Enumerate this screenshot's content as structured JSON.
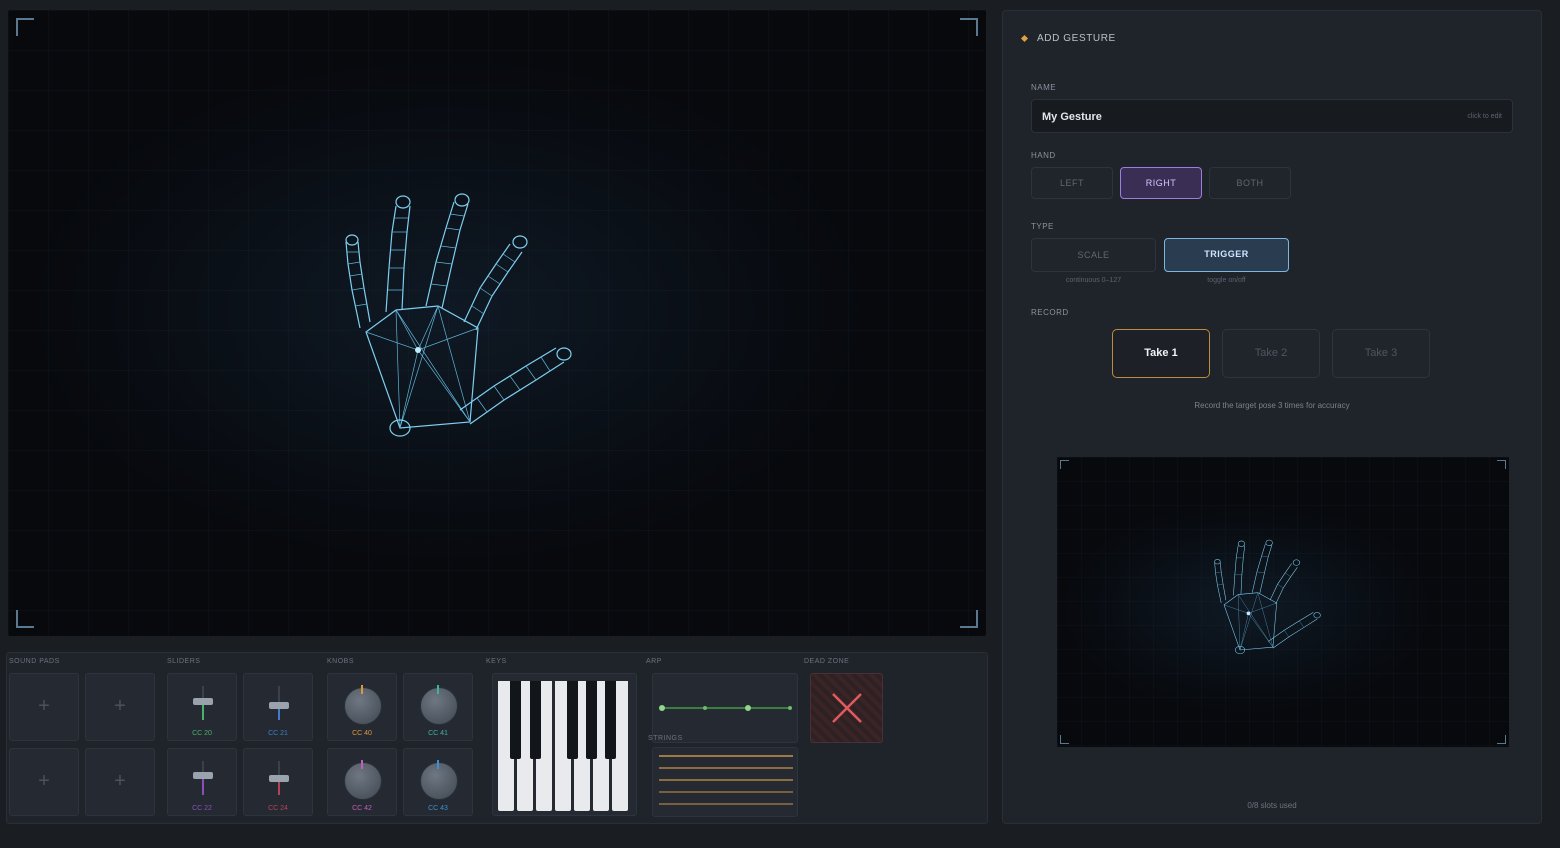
{
  "controls": {
    "groups": {
      "sound_pads": "SOUND PADS",
      "sliders": "SLIDERS",
      "knobs": "KNOBS",
      "keys": "KEYS",
      "arp": "ARP",
      "strings": "STRINGS",
      "dead_zone": "DEAD ZONE"
    },
    "sliders": [
      {
        "cc": "CC 20",
        "color": "#4caf6a",
        "level": 0.55
      },
      {
        "cc": "CC 21",
        "color": "#3f7ec6",
        "level": 0.45
      },
      {
        "cc": "CC 22",
        "color": "#8a4fb8",
        "level": 0.6
      },
      {
        "cc": "CC 24",
        "color": "#b8415a",
        "level": 0.5
      }
    ],
    "knobs": [
      {
        "cc": "CC 40",
        "color": "#e0963c"
      },
      {
        "cc": "CC 41",
        "color": "#3fb39a"
      },
      {
        "cc": "CC 42",
        "color": "#c060b8"
      },
      {
        "cc": "CC 43",
        "color": "#3f8ed0"
      }
    ],
    "pad_icon": "plus-icon",
    "dead_zone_icon": "close-x-icon"
  },
  "panel": {
    "title": "ADD GESTURE",
    "name_label": "NAME",
    "name_value": "My Gesture",
    "name_hint": "click to edit",
    "hand_label": "HAND",
    "hand_options": [
      "LEFT",
      "RIGHT",
      "BOTH"
    ],
    "hand_selected": "RIGHT",
    "type_label": "TYPE",
    "type_options": [
      {
        "label": "SCALE",
        "sub": "continuous 0–127"
      },
      {
        "label": "TRIGGER",
        "sub": "toggle on/off"
      }
    ],
    "type_selected": "TRIGGER",
    "record_label": "RECORD",
    "takes": [
      "Take 1",
      "Take 2",
      "Take 3"
    ],
    "take_current": "Take 1",
    "record_hint": "Record the target pose 3 times for accuracy",
    "slots_text": "0/8 slots used"
  },
  "colors": {
    "accent_orange": "#e0a040",
    "hand_wire": "#7fcff0",
    "purple": "#9b7fe0",
    "blue": "#7fb6e0"
  }
}
